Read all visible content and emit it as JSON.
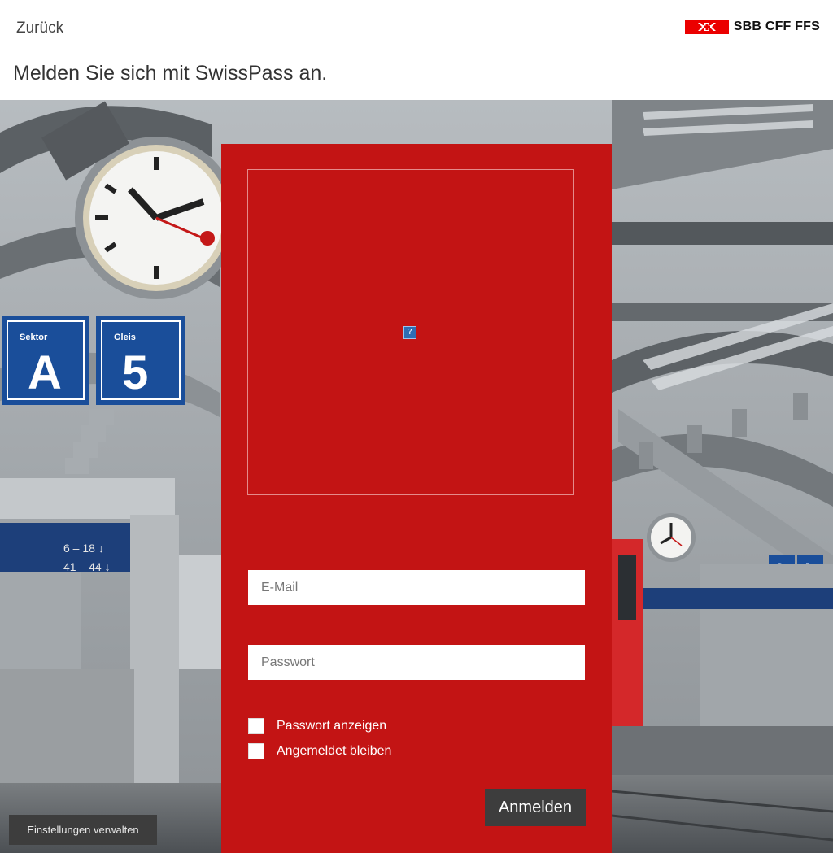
{
  "header": {
    "back_label": "Zurück",
    "brand_name": "SBB CFF FFS",
    "brand_color": "#eb0000"
  },
  "page": {
    "title": "Melden Sie sich mit SwissPass an."
  },
  "background": {
    "sector_sign": {
      "caption": "Sektor",
      "letter": "A"
    },
    "track_sign": {
      "caption": "Gleis",
      "number": "5"
    },
    "far_signs": {
      "number": "6",
      "letter": "A"
    },
    "board_rows": [
      "6 – 18 ↓",
      "41 – 44 ↓"
    ]
  },
  "login": {
    "panel_color": "#c31414",
    "captcha_icon": "broken-image-icon",
    "captcha_icon_glyph": "?",
    "email_placeholder": "E-Mail",
    "password_placeholder": "Passwort",
    "show_password_label": "Passwort anzeigen",
    "stay_logged_in_label": "Angemeldet bleiben",
    "submit_label": "Anmelden"
  },
  "footer": {
    "settings_label": "Einstellungen verwalten"
  }
}
